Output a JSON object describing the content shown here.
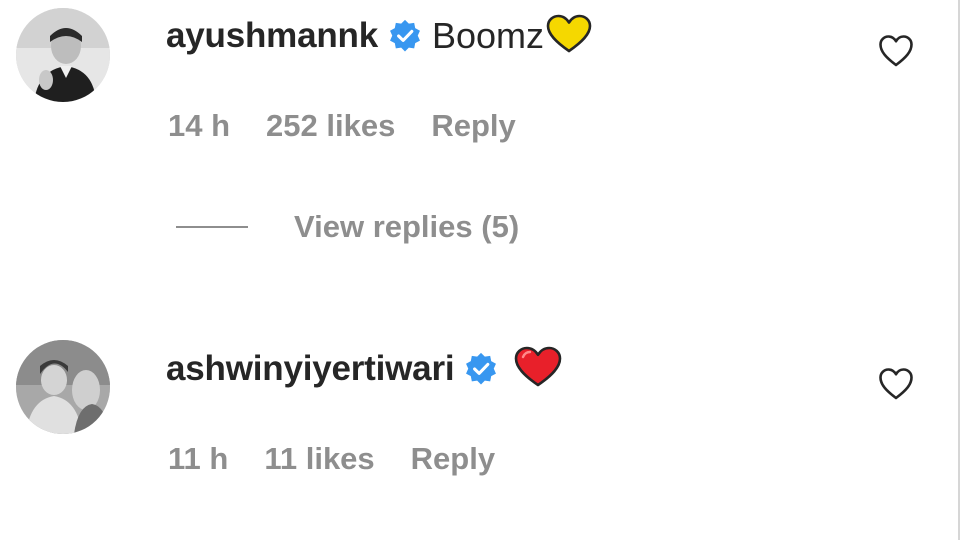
{
  "comments": [
    {
      "username": "ayushmannk",
      "verified": true,
      "text": "Boomz",
      "emoji": "yellow-heart-icon",
      "time": "14 h",
      "likes": "252 likes",
      "reply_label": "Reply",
      "view_replies_label": "View replies (5)"
    },
    {
      "username": "ashwinyiyertiwari",
      "verified": true,
      "text": "",
      "emoji": "red-heart-icon",
      "time": "11 h",
      "likes": "11 likes",
      "reply_label": "Reply"
    }
  ],
  "colors": {
    "username": "#262626",
    "meta": "#8e8e8e",
    "verified": "#3897f0",
    "yellow_heart": "#f5d800",
    "red_heart": "#e8202a"
  }
}
